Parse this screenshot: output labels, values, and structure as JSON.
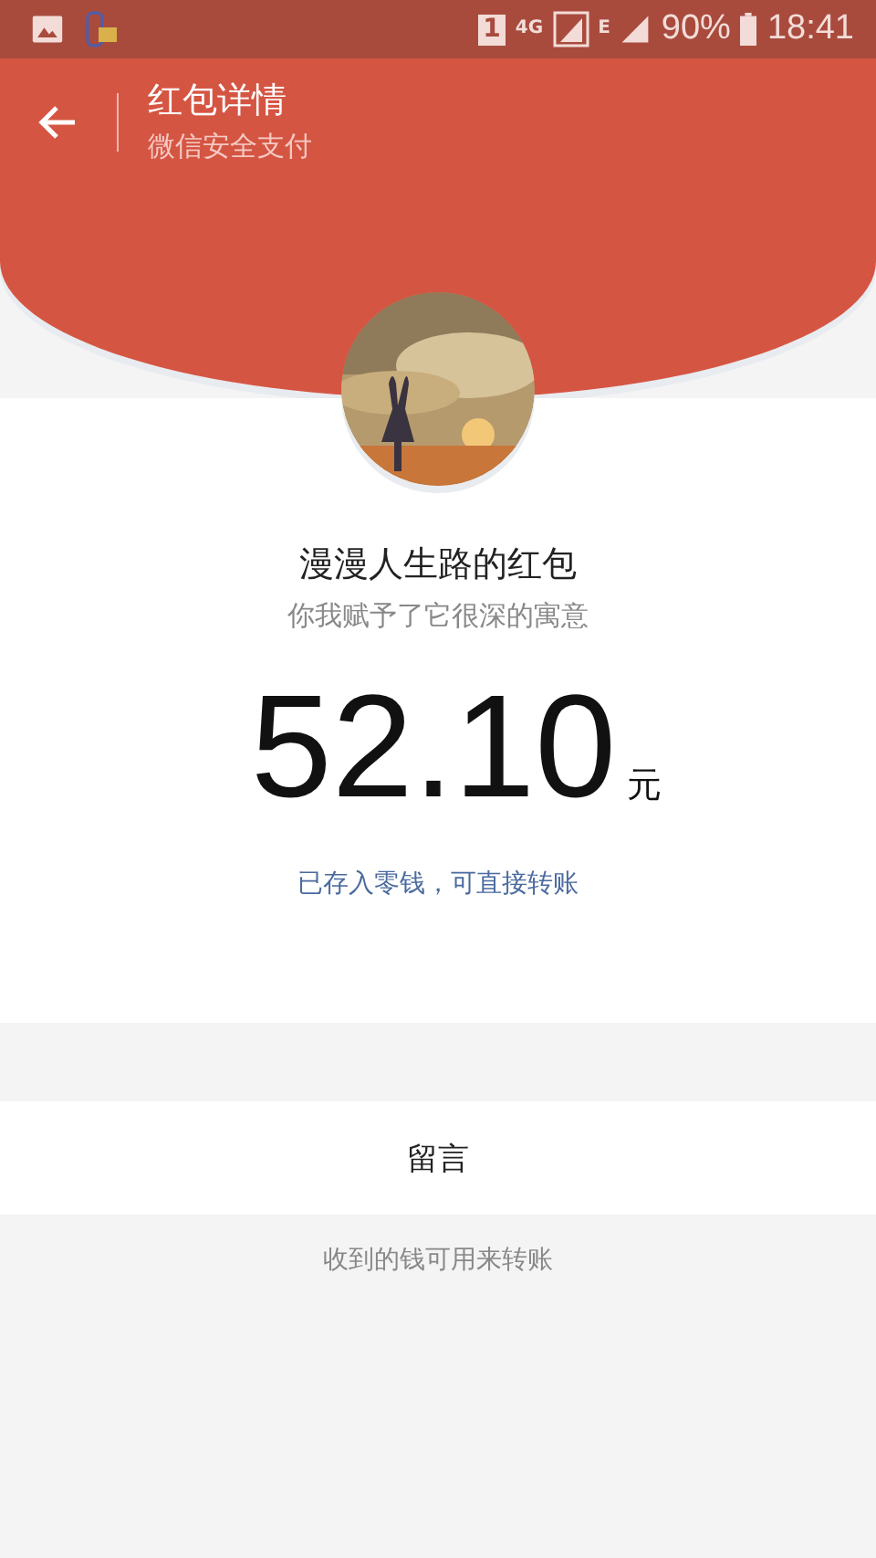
{
  "status_bar": {
    "sim": "1",
    "network": "4G",
    "network_2": "E",
    "battery": "90%",
    "time": "18:41"
  },
  "header": {
    "title": "红包详情",
    "subtitle": "微信安全支付"
  },
  "sender": "漫漫人生路的红包",
  "blessing": "你我赋予了它很深的寓意",
  "amount": {
    "value": "52.10",
    "unit": "元"
  },
  "note": {
    "prefix": "已存入零钱",
    "link": "，可直接转账"
  },
  "message_button": "留言",
  "footer": "收到的钱可用来转账"
}
